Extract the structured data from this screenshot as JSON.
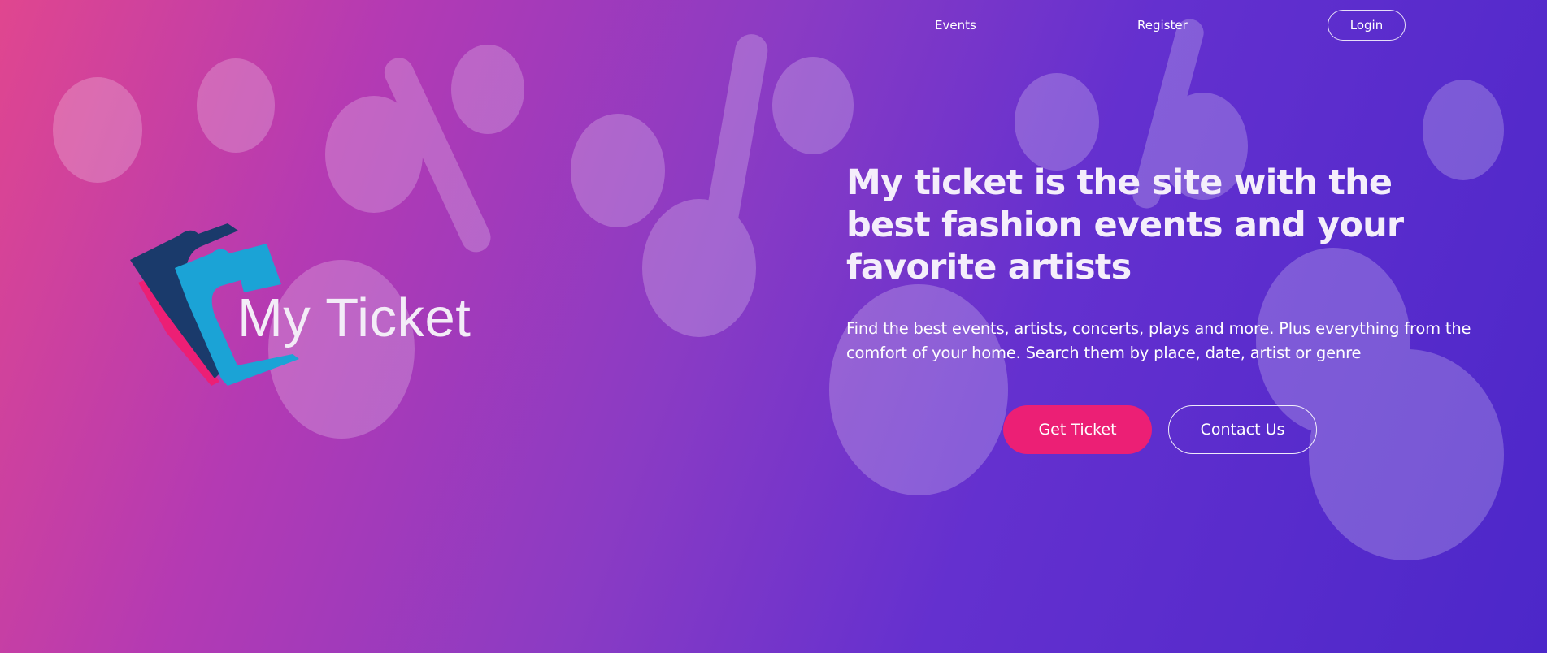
{
  "nav": {
    "events_label": "Events",
    "register_label": "Register",
    "login_label": "Login"
  },
  "brand": {
    "name": "My Ticket"
  },
  "hero": {
    "headline": "My ticket is the site with the best fashion events and your favorite artists",
    "subtext": "Find the best events, artists, concerts, plays and more. Plus everything from the comfort of your home. Search them by place, date, artist or genre",
    "primary_button_label": "Get Ticket",
    "secondary_button_label": "Contact Us"
  },
  "colors": {
    "gradient_start": "#e0468f",
    "gradient_end": "#4c27c9",
    "primary_button": "#ec1f75",
    "logo_navy": "#1a3a6b",
    "logo_cyan": "#1ba3d6",
    "logo_pink": "#ec1f75"
  }
}
